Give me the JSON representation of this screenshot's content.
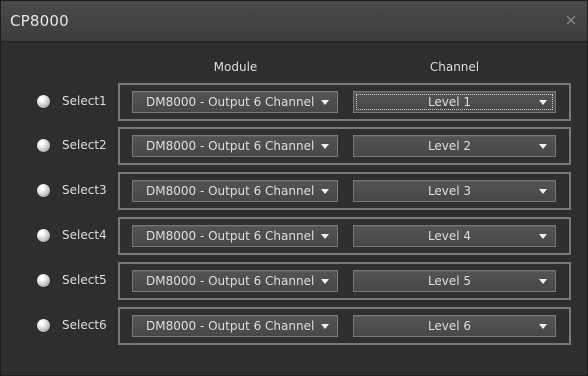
{
  "window": {
    "title": "CP8000",
    "close_symbol": "×"
  },
  "headers": {
    "module": "Module",
    "channel": "Channel"
  },
  "rows": [
    {
      "label": "Select1",
      "module": "DM8000 - Output 6 Channel",
      "channel": "Level 1",
      "focused": true
    },
    {
      "label": "Select2",
      "module": "DM8000 - Output 6 Channel",
      "channel": "Level 2",
      "focused": false
    },
    {
      "label": "Select3",
      "module": "DM8000 - Output 6 Channel",
      "channel": "Level 3",
      "focused": false
    },
    {
      "label": "Select4",
      "module": "DM8000 - Output 6 Channel",
      "channel": "Level 4",
      "focused": false
    },
    {
      "label": "Select5",
      "module": "DM8000 - Output 6 Channel",
      "channel": "Level 5",
      "focused": false
    },
    {
      "label": "Select6",
      "module": "DM8000 - Output 6 Channel",
      "channel": "Level 6",
      "focused": false
    }
  ]
}
